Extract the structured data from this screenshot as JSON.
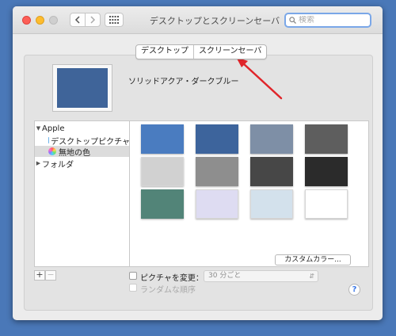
{
  "window": {
    "title": "デスクトップとスクリーンセーバ"
  },
  "search": {
    "placeholder": "検索"
  },
  "tabs": [
    {
      "label": "デスクトップ",
      "selected": true
    },
    {
      "label": "スクリーンセーバ",
      "selected": false
    }
  ],
  "preview": {
    "color_name": "ソリッドアクア・ダークブルー",
    "color": "#3f6499"
  },
  "sidebar": {
    "items": [
      {
        "label": "Apple",
        "expanded": true
      },
      {
        "label": "デスクトップピクチャ"
      },
      {
        "label": "無地の色",
        "selected": true
      },
      {
        "label": "フォルダ",
        "expanded": false
      }
    ]
  },
  "swatches": [
    "#4a7cc0",
    "#3d649c",
    "#7e8fa6",
    "#5e5e5e",
    "#d1d1d1",
    "#8e8e8e",
    "#474747",
    "#2b2b2b",
    "#528478",
    "#dedcf2",
    "#d3e1ec",
    "#ffffff"
  ],
  "custom_color_button": "カスタムカラー...",
  "add_remove": {
    "add": "+",
    "remove": "−"
  },
  "change_picture": {
    "label": "ピクチャを変更：",
    "interval": "30 分ごと"
  },
  "random_order": {
    "label": "ランダムな順序"
  },
  "help": "?",
  "colors": {
    "desktop_bg": "#4a78b8",
    "annotation_arrow": "#e0252a",
    "focus": "#7aa7e8"
  }
}
